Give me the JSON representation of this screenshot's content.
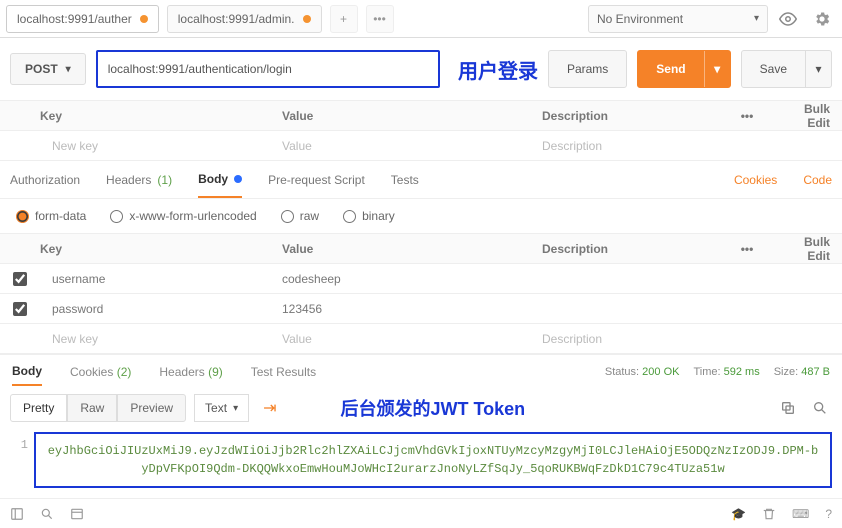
{
  "tabs": [
    {
      "title": "localhost:9991/auther"
    },
    {
      "title": "localhost:9991/admin."
    }
  ],
  "env": {
    "selected": "No Environment"
  },
  "request": {
    "method": "POST",
    "url": "localhost:9991/authentication/login",
    "annotation": "用户登录",
    "params_btn": "Params",
    "send_btn": "Send",
    "save_btn": "Save"
  },
  "param_header": {
    "key": "Key",
    "value": "Value",
    "desc": "Description",
    "bulk": "Bulk Edit",
    "newkey": "New key",
    "newval": "Value",
    "newdesc": "Description",
    "dots": "•••"
  },
  "req_tabs": {
    "auth": "Authorization",
    "headers": "Headers",
    "headers_count": "(1)",
    "body": "Body",
    "prereq": "Pre-request Script",
    "tests": "Tests",
    "cookies": "Cookies",
    "code": "Code"
  },
  "body_types": {
    "form": "form-data",
    "urlenc": "x-www-form-urlencoded",
    "raw": "raw",
    "binary": "binary"
  },
  "body_rows": [
    {
      "key": "username",
      "value": "codesheep"
    },
    {
      "key": "password",
      "value": "123456"
    }
  ],
  "resp_tabs": {
    "body": "Body",
    "cookies": "Cookies",
    "cookies_count": "(2)",
    "headers": "Headers",
    "headers_count": "(9)",
    "tests": "Test Results"
  },
  "status": {
    "status_lbl": "Status:",
    "status_val": "200 OK",
    "time_lbl": "Time:",
    "time_val": "592 ms",
    "size_lbl": "Size:",
    "size_val": "487 B"
  },
  "resp_toolbar": {
    "pretty": "Pretty",
    "raw": "Raw",
    "preview": "Preview",
    "text": "Text",
    "annotation": "后台颁发的JWT Token"
  },
  "response_body": {
    "line_no": "1",
    "token": "eyJhbGciOiJIUzUxMiJ9.eyJzdWIiOiJjb2Rlc2hlZXAiLCJjcmVhdGVkIjoxNTUyMzcyMzgyMjI0LCJleHAiOjE5ODQzNzIzODJ9.DPM-byDpVFKpOI9Qdm-DKQQWkxoEmwHouMJoWHcI2urarzJnoNyLZfSqJy_5qoRUKBWqFzDkD1C79c4TUza51w"
  }
}
